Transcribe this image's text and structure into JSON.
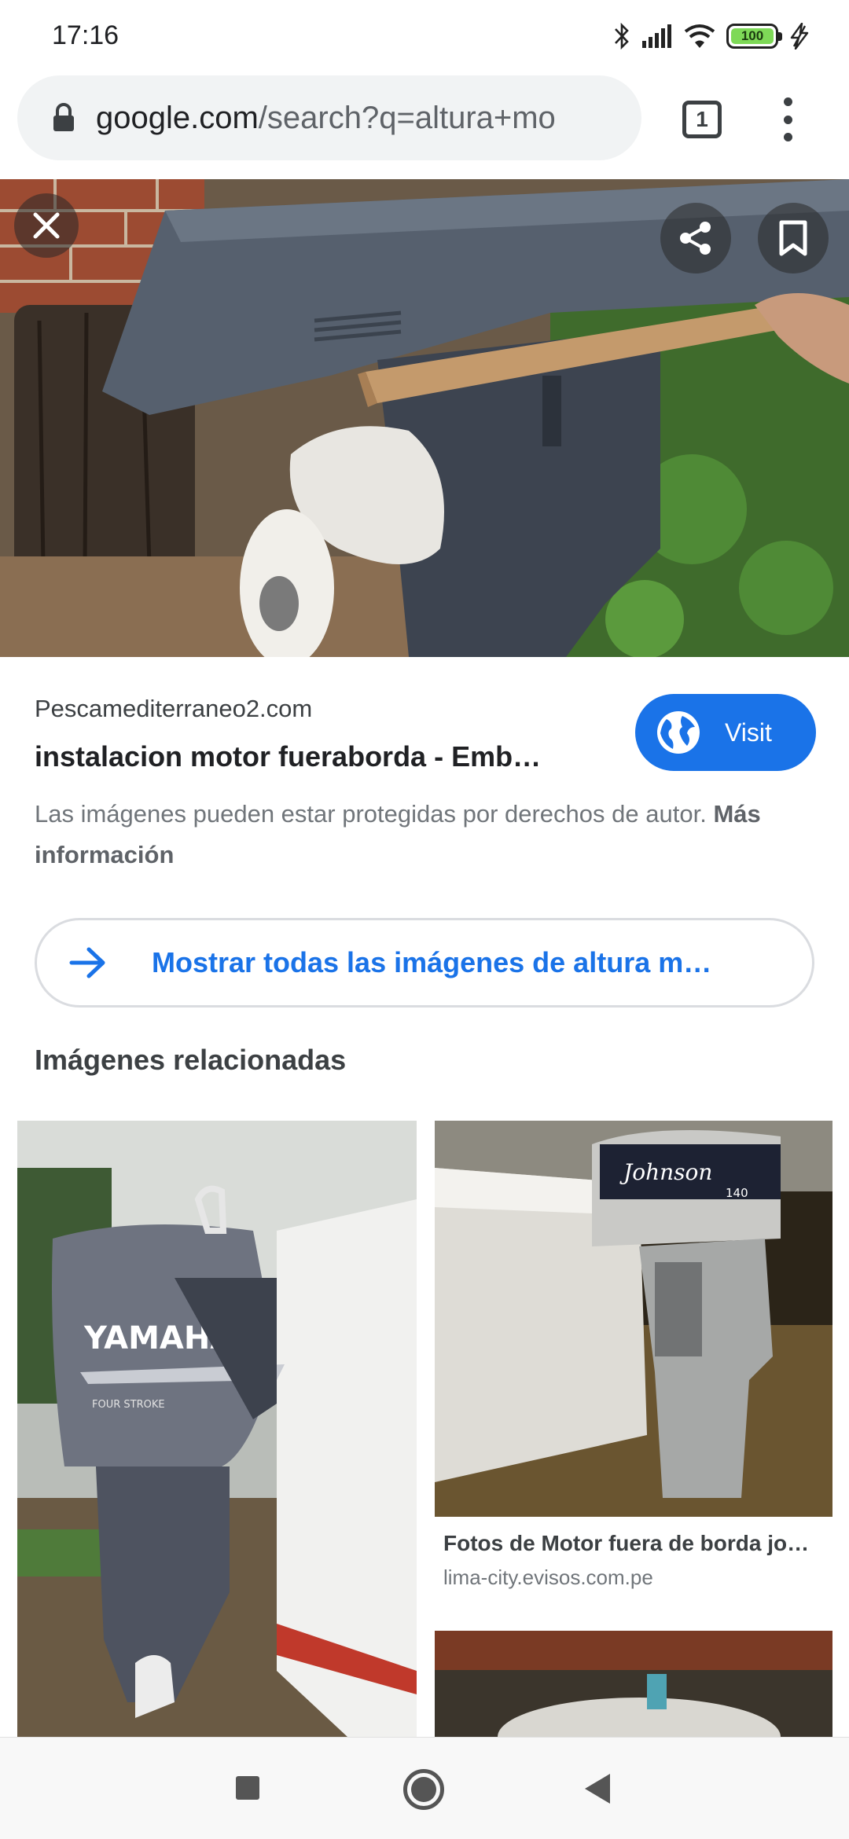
{
  "status_bar": {
    "time": "17:16",
    "battery_level": "100",
    "icons": [
      "bluetooth-icon",
      "signal-icon",
      "wifi-icon",
      "battery-icon",
      "charging-icon"
    ]
  },
  "browser": {
    "url_domain": "google.com",
    "url_path": "/search?q=altura+mo",
    "tab_count": "1",
    "icons": [
      "lock-icon",
      "tab-switcher-icon",
      "overflow-menu-icon"
    ]
  },
  "viewer": {
    "icons": [
      "close-icon",
      "share-icon",
      "bookmark-icon"
    ],
    "source_name": "Pescamediterraneo2.com",
    "title": "instalacion motor fueraborda - Emb…",
    "visit_label": "Visit",
    "copyright_text": "Las imágenes pueden estar protegidas por derechos de autor.",
    "more_info_label": "Más información",
    "show_all_label": "Mostrar todas las imágenes de altura m…"
  },
  "related": {
    "heading": "Imágenes relacionadas",
    "items": [
      {
        "brand": "YAMAHA",
        "sub": "FOUR STROKE"
      },
      {
        "brand": "Johnson",
        "model": "140",
        "title": "Fotos de Motor fuera de borda jo…",
        "source": "lima-city.evisos.com.pe"
      },
      {}
    ]
  },
  "nav_bar": {
    "icons": [
      "recents-icon",
      "home-icon",
      "back-icon"
    ]
  },
  "colors": {
    "accent": "#1a73e8",
    "text": "#202124",
    "muted": "#70757a"
  }
}
